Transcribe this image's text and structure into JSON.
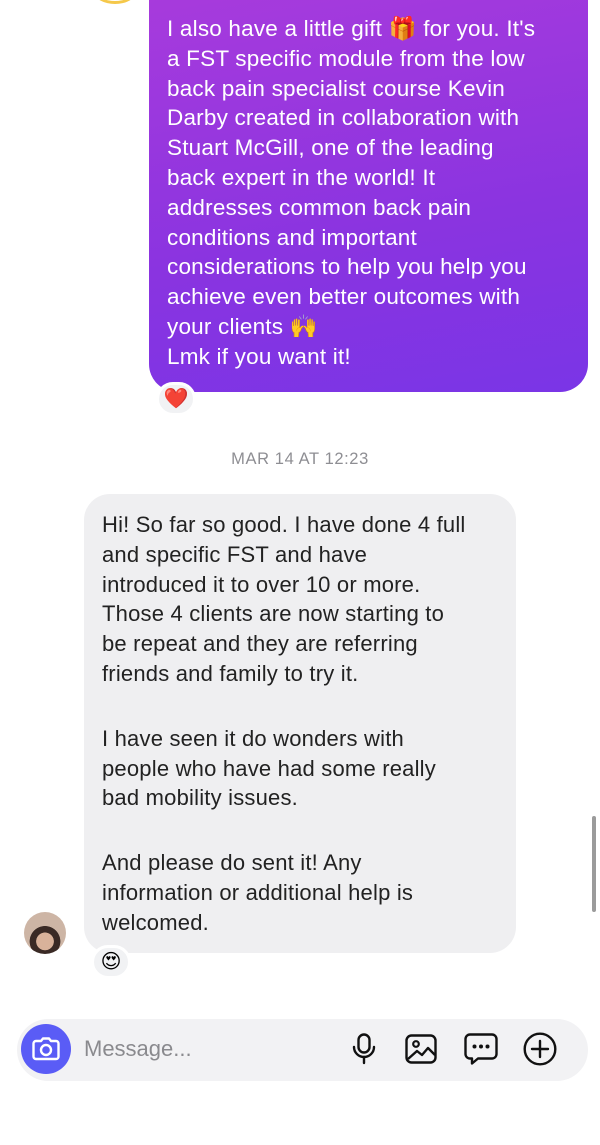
{
  "thread": {
    "outgoing_message": {
      "text": "I also have a little gift 🎁 for you. It's\na FST specific module from the low\nback pain specialist course Kevin\nDarby created in collaboration with\nStuart McGill, one of the leading\nback expert in the world! It\naddresses common back pain\nconditions and important\nconsiderations to help you help you\nachieve even better outcomes with\nyour clients 🙌\nLmk if you want it!",
      "reaction": "❤️"
    },
    "timestamp": "MAR 14 AT 12:23",
    "incoming_message": {
      "paragraphs": [
        "Hi! So far so good. I have done 4 full\nand specific FST and have\nintroduced it to over 10 or more.\nThose 4 clients are now starting to\nbe repeat and they are referring\nfriends and family to try it.",
        "I have seen it do wonders with\npeople who have had some really\nbad mobility issues.",
        "And please do sent it! Any\ninformation or additional help is\nwelcomed."
      ],
      "reaction": "😍"
    }
  },
  "composer": {
    "placeholder": "Message...",
    "value": "",
    "icons": [
      "camera-icon",
      "microphone-icon",
      "gallery-icon",
      "sticker-icon",
      "plus-circle-icon"
    ]
  },
  "colors": {
    "outgoing_gradient_start": "#a93bdc",
    "outgoing_gradient_end": "#7a35e6",
    "incoming_bubble": "#efeff1",
    "camera_button": "#5a5cf6"
  }
}
